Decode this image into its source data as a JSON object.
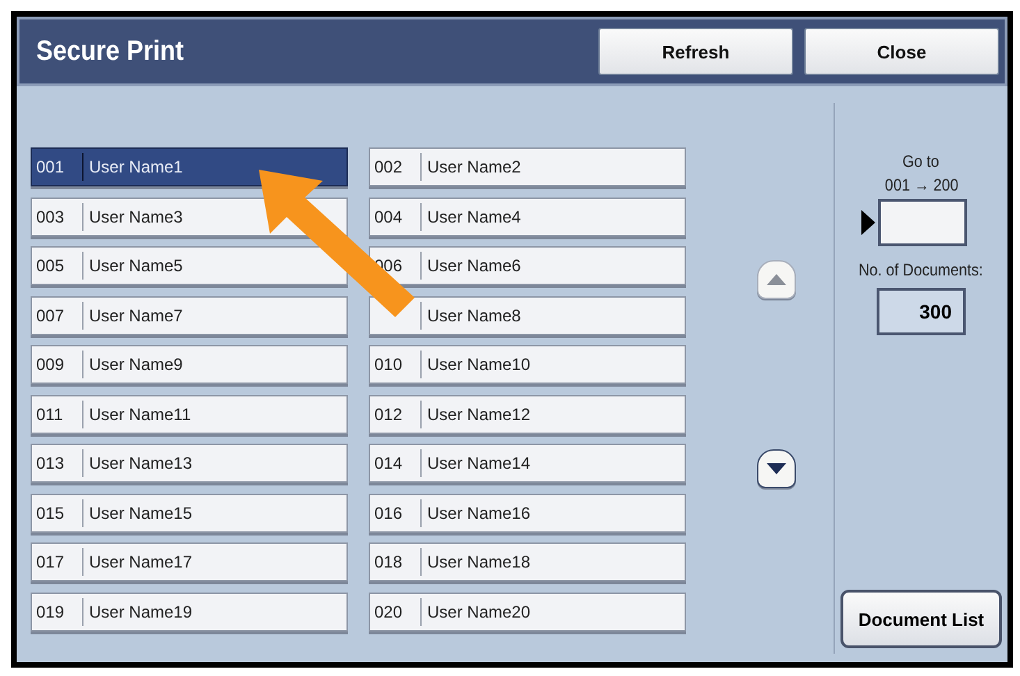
{
  "window": {
    "title": "Secure Print"
  },
  "header_buttons": [
    "Refresh",
    "Close"
  ],
  "users": [
    {
      "number": "001",
      "name": "User Name1",
      "selected": true
    },
    {
      "number": "002",
      "name": "User Name2",
      "selected": false
    },
    {
      "number": "003",
      "name": "User Name3",
      "selected": false
    },
    {
      "number": "004",
      "name": "User Name4",
      "selected": false
    },
    {
      "number": "005",
      "name": "User Name5",
      "selected": false
    },
    {
      "number": "006",
      "name": "User Name6",
      "selected": false
    },
    {
      "number": "007",
      "name": "User Name7",
      "selected": false
    },
    {
      "name": "User Name8",
      "selected": false
    },
    {
      "number": "009",
      "name": "User Name9",
      "selected": false
    },
    {
      "number": "010",
      "name": "User Name10",
      "selected": false
    },
    {
      "number": "011",
      "name": "User Name11",
      "selected": false
    },
    {
      "number": "012",
      "name": "User Name12",
      "selected": false
    },
    {
      "number": "013",
      "name": "User Name13",
      "selected": false
    },
    {
      "number": "014",
      "name": "User Name14",
      "selected": false
    },
    {
      "number": "015",
      "name": "User Name15",
      "selected": false
    },
    {
      "number": "016",
      "name": "User Name16",
      "selected": false
    },
    {
      "number": "017",
      "name": "User Name17",
      "selected": false
    },
    {
      "number": "018",
      "name": "User Name18",
      "selected": false
    },
    {
      "number": "019",
      "name": "User Name19",
      "selected": false
    },
    {
      "number": "020",
      "name": "User Name20",
      "selected": false
    }
  ],
  "scroll": {
    "up_disabled": true
  },
  "go_to": {
    "label": "Go to",
    "range": "001 → 200"
  },
  "documents": {
    "label": "No. of Documents:",
    "value": "300"
  },
  "footer_button": "Document List"
}
